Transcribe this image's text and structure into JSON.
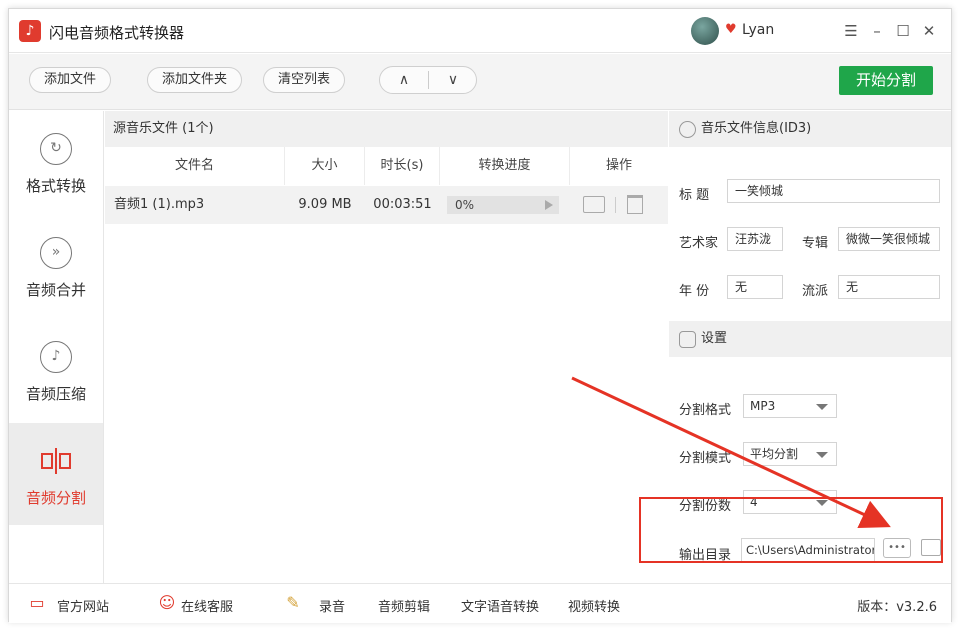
{
  "app": {
    "title": "闪电音频格式转换器",
    "logo_icon": "music-note-icon",
    "user_name": "Lyan"
  },
  "window_controls": {
    "menu": "☰",
    "minimize": "–",
    "maximize": "☐",
    "close": "✕"
  },
  "toolbar": {
    "add_file": "添加文件",
    "add_folder": "添加文件夹",
    "clear_list": "清空列表",
    "move_up": "∧",
    "move_down": "∨",
    "start_label": "开始分割"
  },
  "sidebar": {
    "items": [
      {
        "label": "格式转换",
        "icon": "refresh-icon"
      },
      {
        "label": "音频合并",
        "icon": "merge-icon"
      },
      {
        "label": "音频压缩",
        "icon": "note-icon"
      },
      {
        "label": "音频分割",
        "icon": "split-icon"
      }
    ]
  },
  "file_list": {
    "caption": "源音乐文件 (1个)",
    "columns": [
      "文件名",
      "大小",
      "时长(s)",
      "转换进度",
      "操作"
    ],
    "rows": [
      {
        "name": "音频1 (1).mp3",
        "size": "9.09 MB",
        "duration": "00:03:51",
        "progress": "0%"
      }
    ]
  },
  "id3": {
    "header": "音乐文件信息(ID3)",
    "title_label": "标 题",
    "title_value": "一笑倾城",
    "artist_label": "艺术家",
    "artist_value": "汪苏泷",
    "album_label": "专辑",
    "album_value": "微微一笑很倾城",
    "year_label": "年 份",
    "year_value": "无",
    "genre_label": "流派",
    "genre_value": "无"
  },
  "settings": {
    "header": "设置",
    "format_label": "分割格式",
    "format_value": "MP3",
    "mode_label": "分割模式",
    "mode_value": "平均分割",
    "count_label": "分割份数",
    "count_value": "4",
    "output_label": "输出目录",
    "output_value": "C:\\Users\\Administrator",
    "browse_label": "•••"
  },
  "footer": {
    "website": "官方网站",
    "support": "在线客服",
    "record": "录音",
    "audio_edit": "音频剪辑",
    "tts": "文字语音转换",
    "video": "视频转换",
    "version": "版本：v3.2.6"
  },
  "colors": {
    "accent": "#e03b2e",
    "start_button": "#1fa64a",
    "annotation": "#e53325"
  }
}
